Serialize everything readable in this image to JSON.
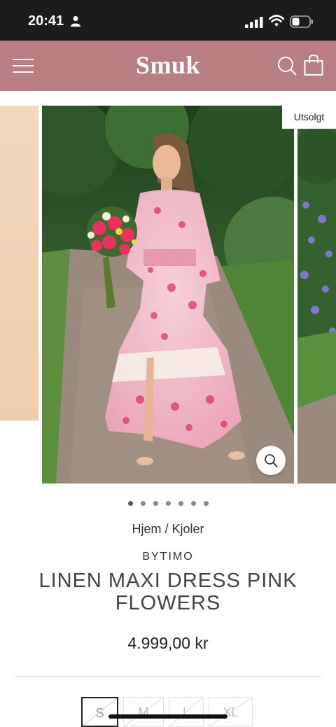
{
  "status": {
    "time": "20:41"
  },
  "header": {
    "logo": "Smuk"
  },
  "gallery": {
    "badge": "Utsolgt",
    "dot_count": 7
  },
  "breadcrumb": {
    "home": "Hjem",
    "separator": " / ",
    "category": "Kjoler"
  },
  "product": {
    "brand": "BYTIMO",
    "title": "LINEN MAXI DRESS PINK FLOWERS",
    "price": "4.999,00 kr"
  },
  "sizes": [
    {
      "label": "S",
      "selected": true
    },
    {
      "label": "M",
      "selected": false
    },
    {
      "label": "L",
      "selected": false
    },
    {
      "label": "XL",
      "selected": false
    }
  ],
  "colors": {
    "header_bg": "#b97d84",
    "status_bg": "#1c1c1c"
  }
}
